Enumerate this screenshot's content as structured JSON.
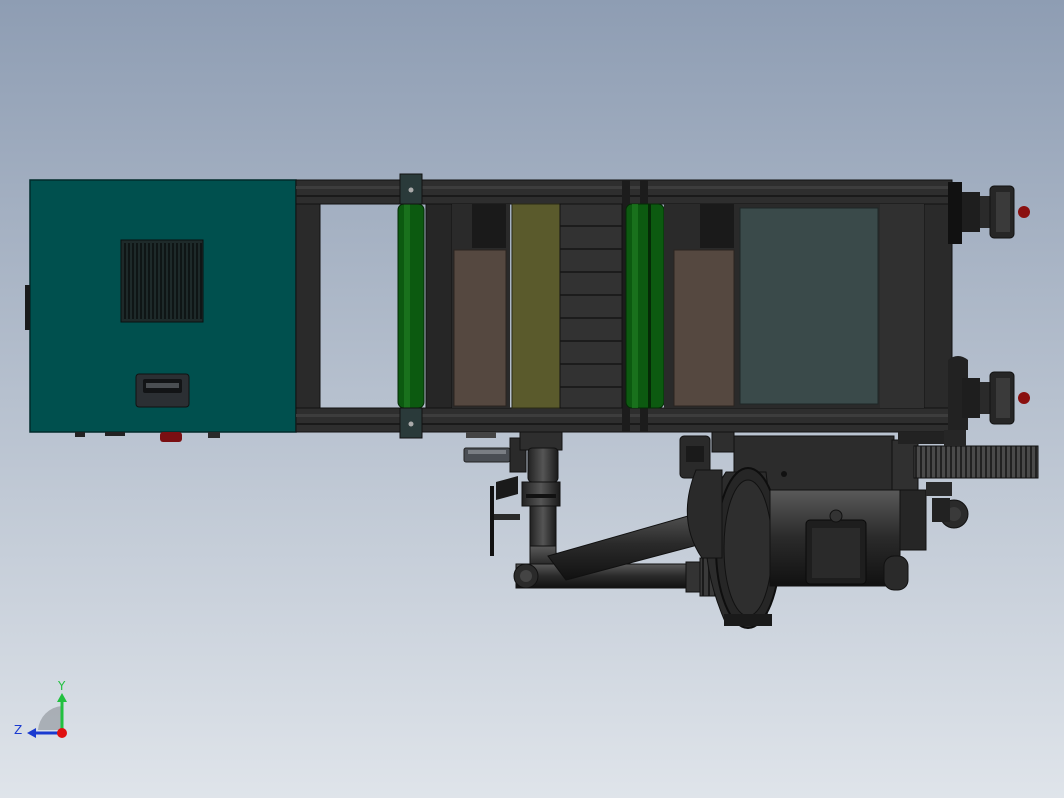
{
  "viewport": {
    "background_top": "#8e9db3",
    "background_bottom": "#dfe4ea"
  },
  "colors": {
    "control_box": "#00504e",
    "roller_green": "#0c5a10",
    "olive_panel": "#5a5a2c",
    "brown_panel": "#554840",
    "slate_panel": "#3a4a4a",
    "frame_dark": "#2b2b2b",
    "axis_y": "#22c040",
    "axis_z": "#1a3ad0",
    "axis_x": "#e01010"
  },
  "triad": {
    "y_label": "Y",
    "z_label": "Z"
  },
  "icons": {
    "triad": "view-orientation-triad-icon",
    "vent": "vent-grille-icon"
  }
}
